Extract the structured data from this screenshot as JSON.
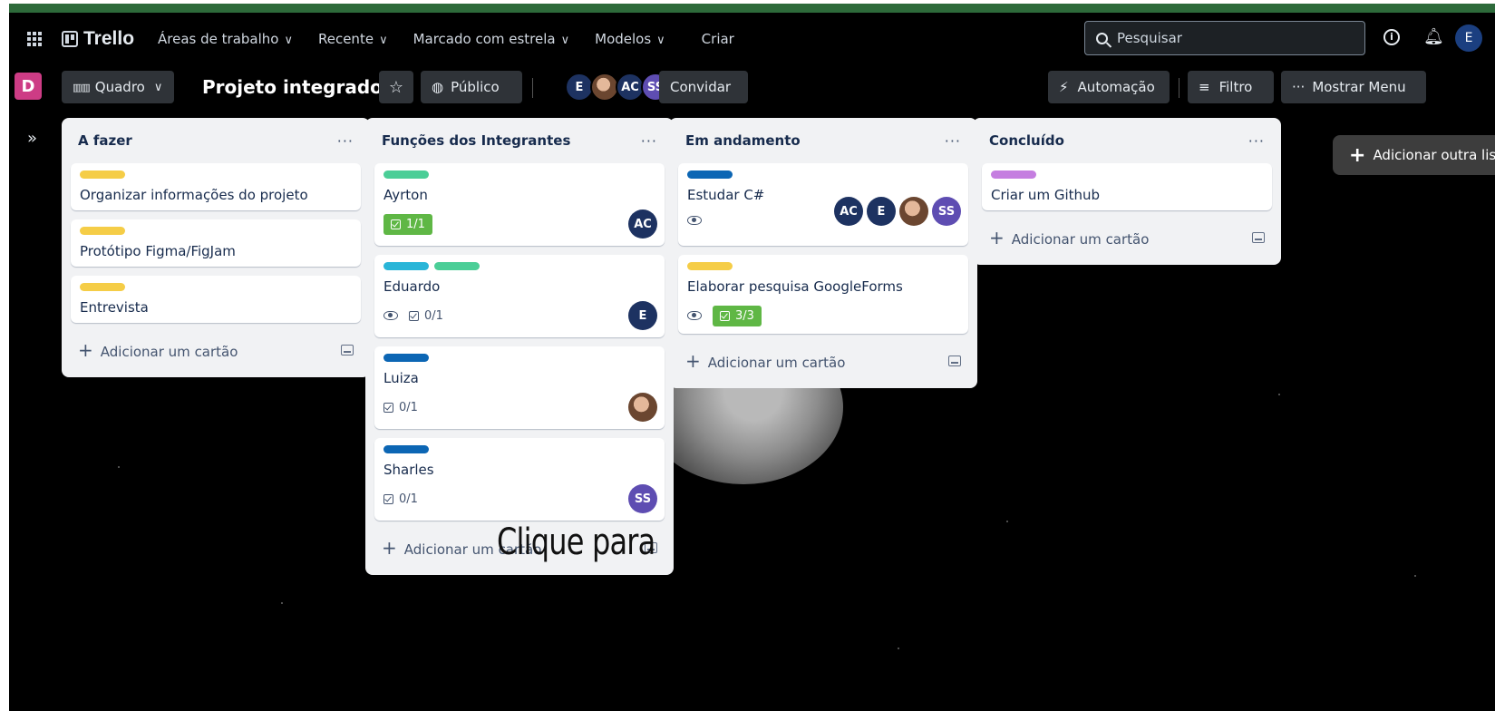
{
  "header": {
    "logo_text": "Trello",
    "nav": [
      {
        "label": "Áreas de trabalho",
        "has_chevron": true
      },
      {
        "label": "Recente",
        "has_chevron": true
      },
      {
        "label": "Marcado com estrela",
        "has_chevron": true
      },
      {
        "label": "Modelos",
        "has_chevron": true
      },
      {
        "label": "Criar",
        "has_chevron": false
      }
    ],
    "search_placeholder": "Pesquisar",
    "user_initial": "E"
  },
  "board": {
    "workspace_initial": "D",
    "view_label": "Quadro",
    "title": "Projeto integrador",
    "visibility": "Público",
    "members": [
      "E",
      "",
      "AC",
      "SS"
    ],
    "invite": "Convidar",
    "automation": "Automação",
    "filter": "Filtro",
    "show_menu": "Mostrar Menu",
    "add_list": "Adicionar outra lista"
  },
  "lists": [
    {
      "title": "A fazer",
      "cards": [
        {
          "labels": [
            "#f5cd47"
          ],
          "title": "Organizar informações do projeto"
        },
        {
          "labels": [
            "#f5cd47"
          ],
          "title": "Protótipo Figma/FigJam"
        },
        {
          "labels": [
            "#f5cd47"
          ],
          "title": "Entrevista"
        }
      ],
      "add_card": "Adicionar um cartão"
    },
    {
      "title": "Funções dos Integrantes",
      "cards": [
        {
          "labels": [
            "#4bce97"
          ],
          "title": "Ayrton",
          "checklist": "1/1",
          "checklist_done": true,
          "members": [
            "AC"
          ]
        },
        {
          "labels": [
            "#29b5d8",
            "#4bce97"
          ],
          "title": "Eduardo",
          "watching": true,
          "checklist": "0/1",
          "members": [
            "E"
          ]
        },
        {
          "labels": [
            "#0c66b4"
          ],
          "title": "Luiza",
          "checklist": "0/1",
          "members": [
            "photo"
          ]
        },
        {
          "labels": [
            "#0c66b4"
          ],
          "title": "Sharles",
          "checklist": "0/1",
          "members": [
            "SS"
          ]
        }
      ],
      "add_card": "Adicionar um cartão"
    },
    {
      "title": "Em andamento",
      "cards": [
        {
          "labels": [
            "#0c66b4"
          ],
          "title": "Estudar C#",
          "watching": true,
          "members": [
            "AC",
            "E",
            "photo",
            "SS"
          ]
        },
        {
          "labels": [
            "#f5cd47"
          ],
          "title": "Elaborar pesquisa GoogleForms",
          "watching": true,
          "checklist": "3/3",
          "checklist_done": true
        }
      ],
      "add_card": "Adicionar um cartão"
    },
    {
      "title": "Concluído",
      "cards": [
        {
          "labels": [
            "#c57ee0"
          ],
          "title": "Criar um Github"
        }
      ],
      "add_card": "Adicionar um cartão"
    }
  ],
  "overlay": {
    "text": "Clique para"
  }
}
